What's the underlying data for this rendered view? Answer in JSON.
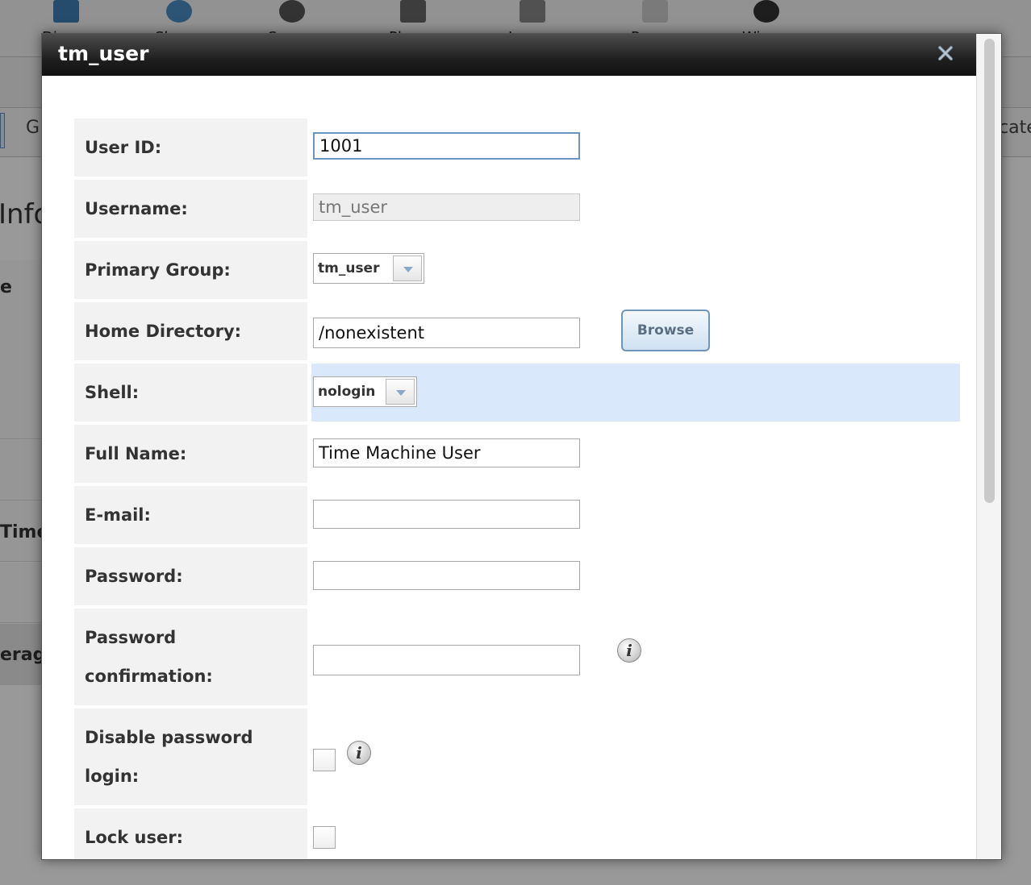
{
  "background": {
    "toolbar_labels": [
      "Di",
      "Sh",
      "Se",
      "Pl",
      "Ja",
      "Re",
      "Wi"
    ],
    "tab_left_text": "G",
    "tab_right_text": "cate",
    "heading_fragment": "Info",
    "side_fragments": [
      "e",
      "Time",
      "erage"
    ]
  },
  "modal": {
    "title": "tm_user",
    "fields": {
      "user_id": {
        "label": "User ID:",
        "value": "1001"
      },
      "username": {
        "label": "Username:",
        "value": "tm_user"
      },
      "primary_group": {
        "label": "Primary Group:",
        "value": "tm_user"
      },
      "home_directory": {
        "label": "Home Directory:",
        "value": "/nonexistent",
        "button": "Browse"
      },
      "shell": {
        "label": "Shell:",
        "value": "nologin"
      },
      "full_name": {
        "label": "Full Name:",
        "value": "Time Machine User"
      },
      "email": {
        "label": "E-mail:",
        "value": ""
      },
      "password": {
        "label": "Password:",
        "value": ""
      },
      "password_confirmation": {
        "label": "Password confirmation:",
        "value": ""
      },
      "disable_password_login": {
        "label": "Disable password login:",
        "checked": false
      },
      "lock_user": {
        "label": "Lock user:",
        "checked": false
      }
    },
    "icons": [
      "close-icon",
      "info-icon"
    ],
    "colors": {
      "titlebar": "#1f1f1f",
      "highlight_row": "#d9e9fb",
      "label_bg": "#f2f2f2",
      "accent": "#6a94c2"
    }
  }
}
